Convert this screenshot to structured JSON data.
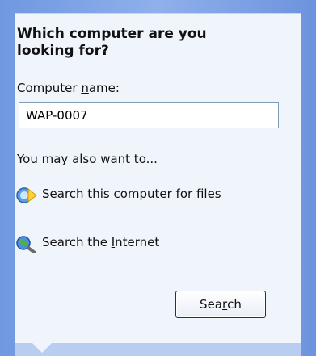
{
  "dialog": {
    "heading": "Which computer are you looking for?",
    "field_label_prefix": "Computer ",
    "field_label_hotkey": "n",
    "field_label_suffix": "ame:",
    "computer_name_value": "WAP-0007",
    "also_label": "You may also want to...",
    "links": [
      {
        "icon": "search-computer-icon",
        "label_hotkey": "S",
        "label_rest": "earch this computer for files"
      },
      {
        "icon": "search-internet-icon",
        "label_prefix": "Search the ",
        "label_hotkey": "I",
        "label_rest": "nternet"
      }
    ],
    "search_button_prefix": "Sea",
    "search_button_hotkey": "r",
    "search_button_suffix": "ch"
  }
}
